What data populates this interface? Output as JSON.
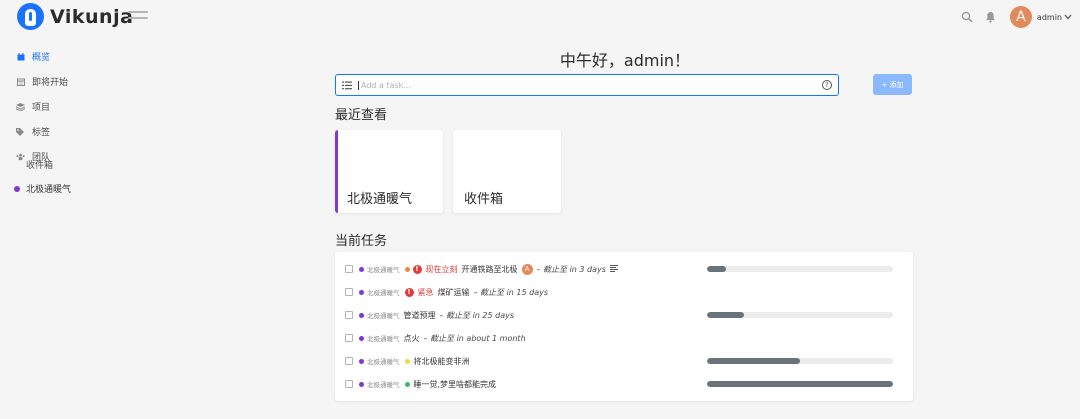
{
  "app": {
    "name": "Vikunja",
    "logo_icon": "vikunja-logo-icon",
    "menu_icon": "hamburger-icon"
  },
  "header": {
    "search_icon": "search-icon",
    "notifications_icon": "bell-icon",
    "avatar_letter": "A",
    "username": "admin",
    "dropdown_icon": "chevron-down-icon"
  },
  "sidebar": {
    "items": [
      {
        "label": "概览",
        "icon": "calendar-icon",
        "active": true
      },
      {
        "label": "即将开始",
        "icon": "calendar-grid-icon",
        "active": false
      },
      {
        "label": "项目",
        "icon": "layers-icon",
        "active": false
      },
      {
        "label": "标签",
        "icon": "tags-icon",
        "active": false
      },
      {
        "label": "团队",
        "icon": "users-icon",
        "active": false
      }
    ],
    "section_label": "收件箱",
    "project": {
      "name": "北极通暖气",
      "color": "#7e38d6"
    }
  },
  "main": {
    "greeting": "中午好，admin！",
    "add_task": {
      "placeholder": "Add a task...",
      "button_label": "+ 添加"
    },
    "recent_title": "最近查看",
    "recent_cards": [
      {
        "title": "北极通暖气",
        "accent": "#7e38d6"
      },
      {
        "title": "收件箱",
        "accent": ""
      }
    ],
    "current_tasks_title": "当前任务",
    "tasks": [
      {
        "project": "北极通暖气",
        "label_dot": "#f08a3b",
        "priority_text": "现在立刻",
        "title": "开通铁路至北极",
        "assignee": "A",
        "due": "– 截止至 in 3 days",
        "has_description": true,
        "progress": 0.1
      },
      {
        "project": "北极通暖气",
        "label_dot": "",
        "priority_text": "紧急",
        "title": "煤矿运输",
        "assignee": "",
        "due": "– 截止至 in 15 days",
        "has_description": false,
        "progress": null
      },
      {
        "project": "北极通暖气",
        "label_dot": "",
        "priority_text": "",
        "title": "管道预埋",
        "assignee": "",
        "due": "– 截止至 in 25 days",
        "has_description": false,
        "progress": 0.2
      },
      {
        "project": "北极通暖气",
        "label_dot": "",
        "priority_text": "",
        "title": "点火",
        "assignee": "",
        "due": "– 截止至 in about 1 month",
        "has_description": false,
        "progress": null
      },
      {
        "project": "北极通暖气",
        "label_dot": "#f5d93b",
        "priority_text": "",
        "title": "将北极能变非洲",
        "assignee": "",
        "due": "",
        "has_description": false,
        "progress": 0.5
      },
      {
        "project": "北极通暖气",
        "label_dot": "#3bb86a",
        "priority_text": "",
        "title": "睡一觉,梦里啥都能完成",
        "assignee": "",
        "due": "",
        "has_description": false,
        "progress": 1.0
      }
    ]
  }
}
